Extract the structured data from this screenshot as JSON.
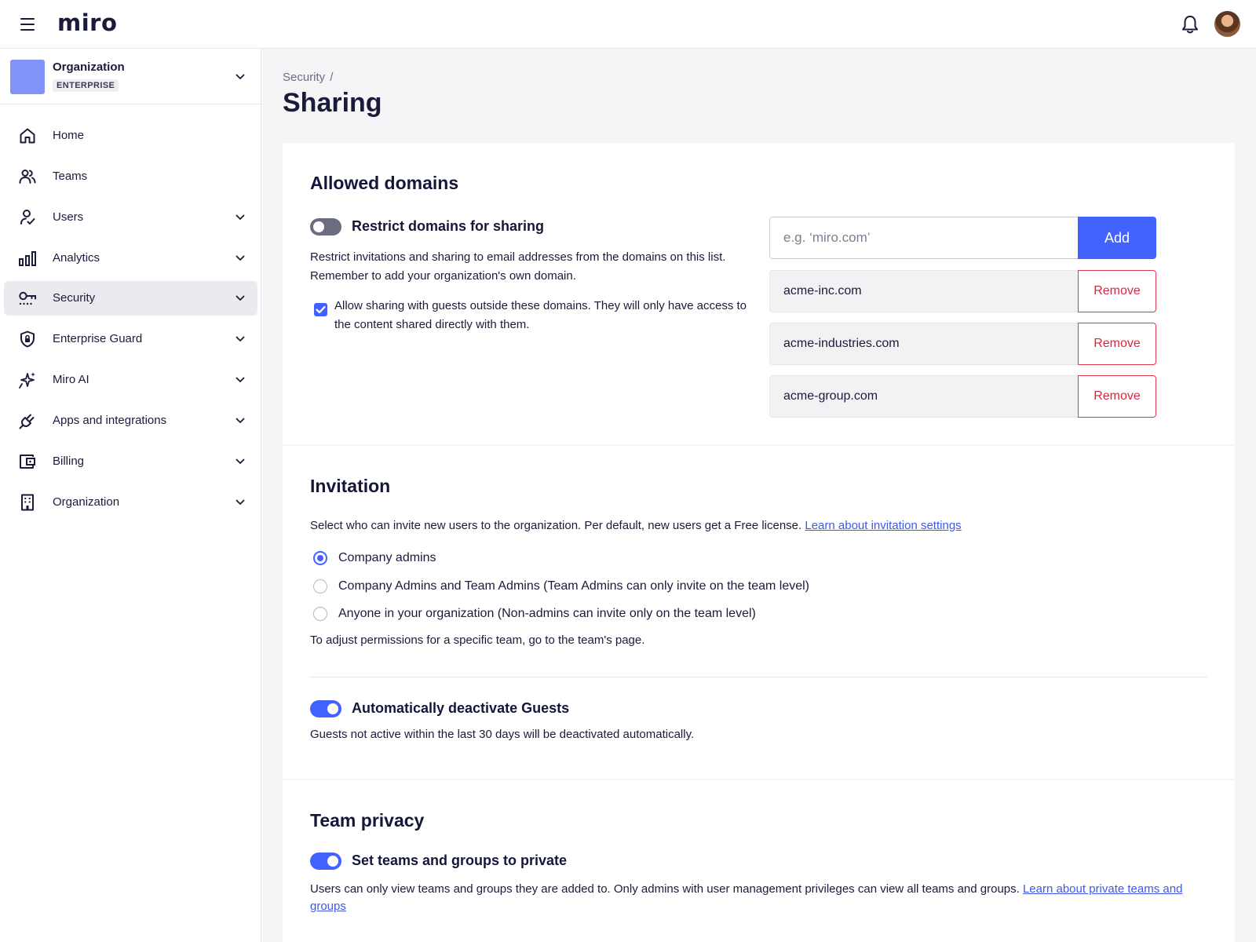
{
  "app": {
    "logo": "miro"
  },
  "sidebar": {
    "org": {
      "name": "Organization",
      "badge": "ENTERPRISE",
      "tile_color": "#8093f8"
    },
    "items": [
      {
        "label": "Home",
        "icon": "home-icon",
        "has_chevron": false,
        "active": false
      },
      {
        "label": "Teams",
        "icon": "teams-icon",
        "has_chevron": false,
        "active": false
      },
      {
        "label": "Users",
        "icon": "users-icon",
        "has_chevron": true,
        "active": false
      },
      {
        "label": "Analytics",
        "icon": "analytics-icon",
        "has_chevron": true,
        "active": false
      },
      {
        "label": "Security",
        "icon": "key-icon",
        "has_chevron": true,
        "active": true
      },
      {
        "label": "Enterprise Guard",
        "icon": "shield-lock-icon",
        "has_chevron": true,
        "active": false
      },
      {
        "label": "Miro AI",
        "icon": "sparkle-icon",
        "has_chevron": true,
        "active": false
      },
      {
        "label": "Apps and integrations",
        "icon": "plug-icon",
        "has_chevron": true,
        "active": false
      },
      {
        "label": "Billing",
        "icon": "wallet-icon",
        "has_chevron": true,
        "active": false
      },
      {
        "label": "Organization",
        "icon": "building-icon",
        "has_chevron": true,
        "active": false
      }
    ]
  },
  "main": {
    "breadcrumb": "Security",
    "breadcrumb_sep": "/",
    "title": "Sharing",
    "allowed_domains": {
      "title": "Allowed domains",
      "toggle_label": "Restrict domains for sharing",
      "toggle_on": false,
      "description": "Restrict invitations and sharing to email addresses from the domains on this list. Remember to add your organization's own domain.",
      "checkbox_label": "Allow sharing with guests outside these domains. They will only have access to the content shared directly with them.",
      "checkbox_checked": true,
      "input_value": "",
      "input_placeholder": "e.g. ‘miro.com’",
      "add_label": "Add",
      "remove_label": "Remove",
      "domains": [
        "acme-inc.com",
        "acme-industries.com",
        "acme-group.com"
      ]
    },
    "invitation": {
      "title": "Invitation",
      "description": "Select who can invite new users to the organization. Per default, new users get a Free license.",
      "link": "Learn about invitation settings",
      "options": [
        {
          "label": "Company admins",
          "checked": true
        },
        {
          "label": "Company Admins and Team Admins (Team Admins can only invite on the team level)",
          "checked": false
        },
        {
          "label": "Anyone in your organization (Non-admins can invite only on the team level)",
          "checked": false
        }
      ],
      "footnote": "To adjust permissions for a specific team, go to the team's page.",
      "guest_toggle_label": "Automatically deactivate Guests",
      "guest_toggle_on": true,
      "guest_description": "Guests not active within the last 30 days will be deactivated automatically."
    },
    "team_privacy": {
      "title": "Team privacy",
      "toggle_label": "Set teams and groups to private",
      "toggle_on": true,
      "description": "Users can only view teams and groups they are added to. Only admins with user management privileges can view all teams and groups.",
      "link": "Learn about private teams and groups"
    }
  },
  "colors": {
    "accent": "#4262ff",
    "danger": "#d6293f",
    "text": "#1a1b3a"
  }
}
